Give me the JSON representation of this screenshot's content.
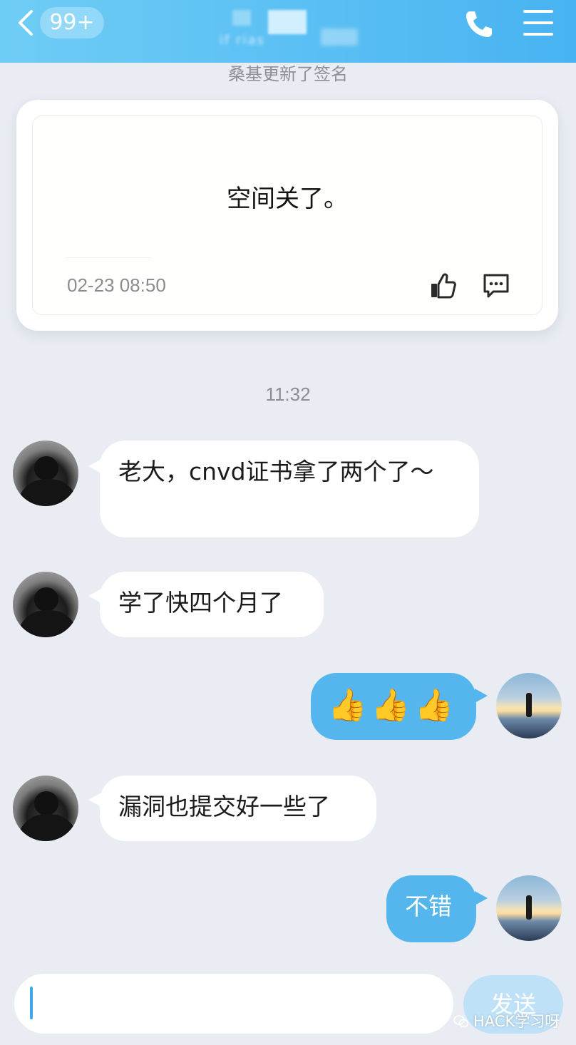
{
  "header": {
    "back_icon": "chevron-left-icon",
    "unread_badge": "99+",
    "title_blurred": "if      rias",
    "call_icon": "phone-icon",
    "menu_icon": "hamburger-menu-icon",
    "colors": {
      "gradient_start": "#6fcdf5",
      "gradient_end": "#48b3f2"
    }
  },
  "signature_notice": "桑基更新了签名",
  "signature_card": {
    "text": "空间关了。",
    "timestamp": "02-23 08:50",
    "like_icon": "thumbs-up-icon",
    "comment_icon": "comment-icon"
  },
  "time_divider": "11:32",
  "messages": [
    {
      "side": "left",
      "text": "老大，cnvd证书拿了两个了～"
    },
    {
      "side": "left",
      "text": "学了快四个月了"
    },
    {
      "side": "right",
      "text": "👍👍👍"
    },
    {
      "side": "left",
      "text": "漏洞也提交好一些了"
    },
    {
      "side": "right",
      "text": "不错"
    }
  ],
  "composer": {
    "input_value": "",
    "send_label": "发送"
  },
  "watermark": "HACK学习呀",
  "colors": {
    "background": "#e9ecf3",
    "bubble_left": "#ffffff",
    "bubble_right": "#55b6ee"
  }
}
